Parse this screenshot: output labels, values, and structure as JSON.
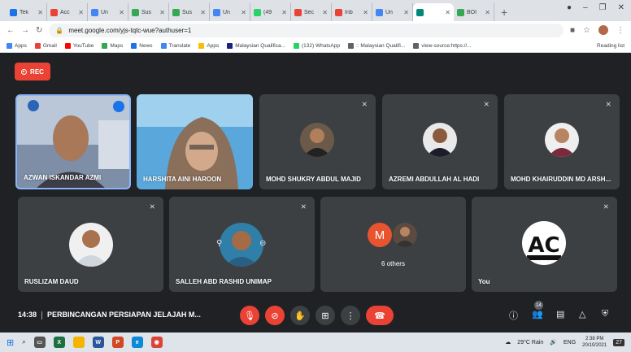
{
  "browser": {
    "tabs": [
      {
        "label": "Tek",
        "color": "#1a73e8"
      },
      {
        "label": "Acc",
        "color": "#ea4335"
      },
      {
        "label": "Un",
        "color": "#4285f4"
      },
      {
        "label": "Sus",
        "color": "#34a853"
      },
      {
        "label": "Sus",
        "color": "#34a853"
      },
      {
        "label": "Un",
        "color": "#4285f4"
      },
      {
        "label": "(49",
        "color": "#25d366"
      },
      {
        "label": "Sec",
        "color": "#ea4335"
      },
      {
        "label": "Inb",
        "color": "#ea4335"
      },
      {
        "label": "Un",
        "color": "#4285f4"
      },
      {
        "label": "",
        "color": "#00897b"
      },
      {
        "label": "BOI",
        "color": "#34a853"
      }
    ],
    "new_tab": "+",
    "url": "meet.google.com/yjs-tqtc-wue?authuser=1",
    "bookmarks": [
      {
        "label": "Apps",
        "color": "#4285f4"
      },
      {
        "label": "Gmail",
        "color": "#ea4335"
      },
      {
        "label": "YouTube",
        "color": "#ff0000"
      },
      {
        "label": "Maps",
        "color": "#34a853"
      },
      {
        "label": "News",
        "color": "#1a73e8"
      },
      {
        "label": "Translate",
        "color": "#4285f4"
      },
      {
        "label": "Apps",
        "color": "#fbbc04"
      },
      {
        "label": "Malaysian Qualifica...",
        "color": "#1a237e"
      },
      {
        "label": "(132) WhatsApp",
        "color": "#25d366"
      },
      {
        "label": ":: Malaysian Qualifi...",
        "color": "#5f6368"
      },
      {
        "label": "view-source:https://...",
        "color": "#5f6368"
      }
    ],
    "reading_list": "Reading list"
  },
  "meet": {
    "rec_label": "REC",
    "participants": [
      {
        "name": "AZWAN ISKANDAR AZMI",
        "video": true
      },
      {
        "name": "HARSHITA AINI HAROON",
        "video": true
      },
      {
        "name": "MOHD SHUKRY ABDUL MAJID",
        "video": false
      },
      {
        "name": "AZREMI ABDULLAH AL HADI",
        "video": false
      },
      {
        "name": "MOHD KHAIRUDDIN MD ARSH...",
        "video": false
      },
      {
        "name": "RUSLIZAM DAUD",
        "video": false
      },
      {
        "name": "SALLEH ABD RASHID UNIMAP",
        "video": false
      },
      {
        "name": "6 others",
        "video": false,
        "initial": "M"
      },
      {
        "name": "You",
        "video": false
      }
    ],
    "time": "14:38",
    "meeting_title": "PERBINCANGAN PERSIAPAN JELAJAH M...",
    "participant_count": "14",
    "colors": {
      "red": "#ea4335",
      "grey": "#3c4043",
      "tile": "#3c4043",
      "bg": "#202124"
    }
  },
  "taskbar": {
    "weather": "29°C  Rain",
    "lang": "ENG",
    "time": "2:38 PM",
    "date": "20/10/2021",
    "notif": "27"
  }
}
